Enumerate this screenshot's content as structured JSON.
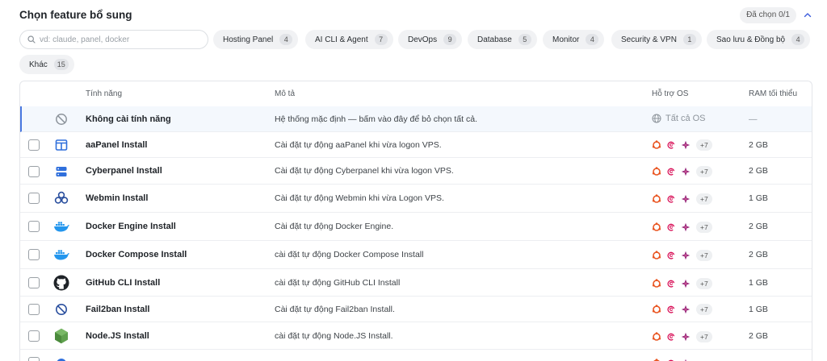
{
  "header": {
    "title": "Chọn feature bổ sung",
    "selected": "Đã chọn 0/1"
  },
  "search": {
    "placeholder": "vd: claude, panel, docker",
    "value": ""
  },
  "categories": [
    {
      "label": "Hosting Panel",
      "count": "4"
    },
    {
      "label": "AI CLI & Agent",
      "count": "7"
    },
    {
      "label": "DevOps",
      "count": "9"
    },
    {
      "label": "Database",
      "count": "5"
    },
    {
      "label": "Monitor",
      "count": "4"
    },
    {
      "label": "Security & VPN",
      "count": "1"
    },
    {
      "label": "Sao lưu & Đồng bộ",
      "count": "4"
    },
    {
      "label": "Khác",
      "count": "15"
    }
  ],
  "table": {
    "columns": {
      "feature": "Tính năng",
      "description": "Mô tả",
      "os": "Hỗ trợ OS",
      "ram": "RAM tối thiểu"
    },
    "none_row": {
      "name": "Không cài tính năng",
      "description": "Hệ thống mặc định — bấm vào đây để bỏ chọn tất cả.",
      "os": "Tất cả OS",
      "ram": "—"
    },
    "rows": [
      {
        "name": "aaPanel Install",
        "description": "Cài đặt tự động aaPanel khi vừa logon VPS.",
        "os_more": "+7",
        "ram": "2 GB",
        "icon": "aapanel-icon"
      },
      {
        "name": "Cyberpanel Install",
        "description": "Cài đặt tự động Cyberpanel khi vừa logon VPS.",
        "os_more": "+7",
        "ram": "2 GB",
        "icon": "cyberpanel-icon"
      },
      {
        "name": "Webmin Install",
        "description": "Cài đặt tự động Webmin khi vừa Logon VPS.",
        "os_more": "+7",
        "ram": "1 GB",
        "icon": "webmin-icon"
      },
      {
        "name": "Docker Engine Install",
        "description": "Cài đặt tự động Docker Engine.",
        "os_more": "+7",
        "ram": "2 GB",
        "icon": "docker-icon"
      },
      {
        "name": "Docker Compose Install",
        "description": "cài đặt tự động Docker Compose Install",
        "os_more": "+7",
        "ram": "2 GB",
        "icon": "docker-icon"
      },
      {
        "name": "GitHub CLI Install",
        "description": "cài đặt tự động GitHub CLI Install",
        "os_more": "+7",
        "ram": "1 GB",
        "icon": "github-icon"
      },
      {
        "name": "Fail2ban Install",
        "description": "Cài đặt tự động Fail2ban Install.",
        "os_more": "+7",
        "ram": "1 GB",
        "icon": "ban-icon"
      },
      {
        "name": "Node.JS Install",
        "description": "cài đặt tự động Node.JS Install.",
        "os_more": "+7",
        "ram": "2 GB",
        "icon": "nodejs-icon"
      }
    ]
  },
  "colors": {
    "accent": "#4a78e0",
    "ubuntu": "#e95420",
    "debian": "#d70a53",
    "centos": "#932279"
  }
}
